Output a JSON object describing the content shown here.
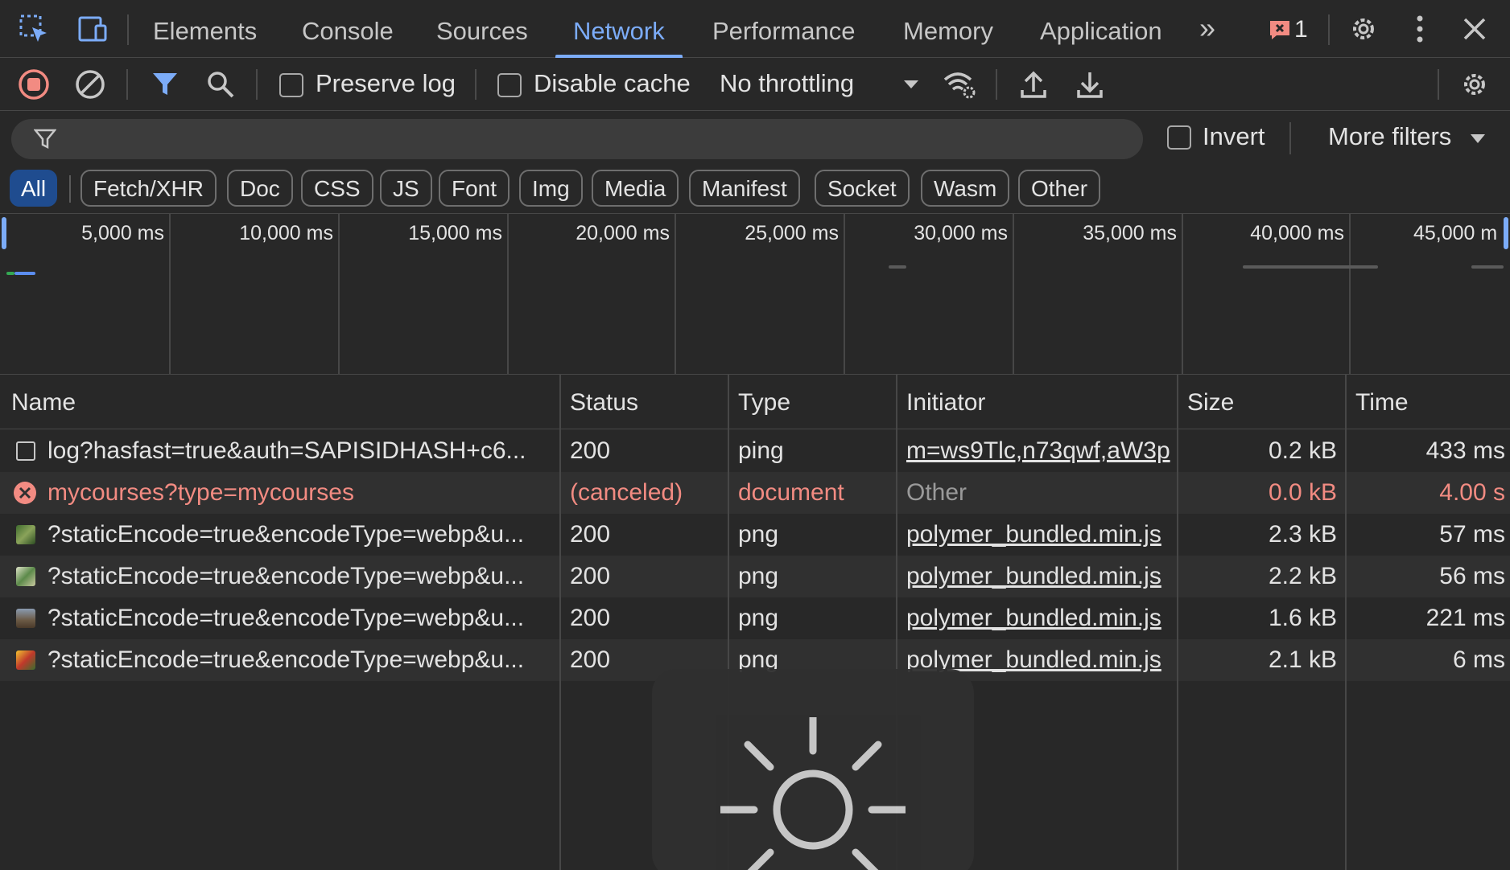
{
  "tabs": {
    "items": [
      "Elements",
      "Console",
      "Sources",
      "Network",
      "Performance",
      "Memory",
      "Application"
    ],
    "active": "Network",
    "more_glyph": "»",
    "error_count": "1"
  },
  "toolbar": {
    "preserve_log": "Preserve log",
    "disable_cache": "Disable cache",
    "throttling": "No throttling"
  },
  "filter": {
    "placeholder": "",
    "invert": "Invert",
    "more_filters": "More filters"
  },
  "chips": [
    "All",
    "Fetch/XHR",
    "Doc",
    "CSS",
    "JS",
    "Font",
    "Img",
    "Media",
    "Manifest",
    "Socket",
    "Wasm",
    "Other"
  ],
  "timeline": {
    "labels": [
      "5,000 ms",
      "10,000 ms",
      "15,000 ms",
      "20,000 ms",
      "25,000 ms",
      "30,000 ms",
      "35,000 ms",
      "40,000 ms",
      "45,000 m"
    ]
  },
  "table": {
    "headers": [
      "Name",
      "Status",
      "Type",
      "Initiator",
      "Size",
      "Time"
    ],
    "rows": [
      {
        "name": "log?hasfast=true&auth=SAPISIDHASH+c6...",
        "status": "200",
        "type": "ping",
        "initiator": "m=ws9Tlc,n73qwf,aW3p",
        "size": "0.2 kB",
        "time": "433 ms"
      },
      {
        "name": "mycourses?type=mycourses",
        "status": "(canceled)",
        "type": "document",
        "initiator": "Other",
        "size": "0.0 kB",
        "time": "4.00 s"
      },
      {
        "name": "?staticEncode=true&encodeType=webp&u...",
        "status": "200",
        "type": "png",
        "initiator": "polymer_bundled.min.js",
        "size": "2.3 kB",
        "time": "57 ms"
      },
      {
        "name": "?staticEncode=true&encodeType=webp&u...",
        "status": "200",
        "type": "png",
        "initiator": "polymer_bundled.min.js",
        "size": "2.2 kB",
        "time": "56 ms"
      },
      {
        "name": "?staticEncode=true&encodeType=webp&u...",
        "status": "200",
        "type": "png",
        "initiator": "polymer_bundled.min.js",
        "size": "1.6 kB",
        "time": "221 ms"
      },
      {
        "name": "?staticEncode=true&encodeType=webp&u...",
        "status": "200",
        "type": "png",
        "initiator": "polymer_bundled.min.js",
        "size": "2.1 kB",
        "time": "6 ms"
      }
    ]
  },
  "colors": {
    "accent": "#7cacf8",
    "error": "#f28b82",
    "record": "#f28b82"
  }
}
